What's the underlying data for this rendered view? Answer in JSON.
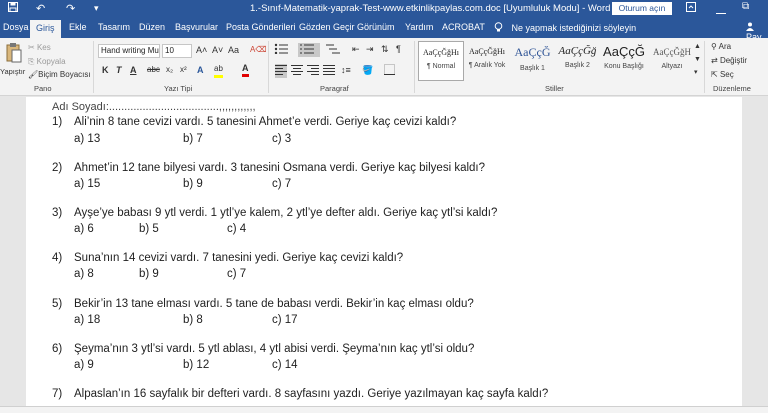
{
  "titlebar": {
    "title": "1.-Sınıf-Matematik-yaprak-Test-www.etkinlikpaylas.com.doc [Uyumluluk Modu] - Word",
    "signin": "Oturum açın",
    "save_icon": "save-icon",
    "undo": "↶",
    "redo": "↷",
    "customize": "▾",
    "restore": "⧉"
  },
  "tabs": [
    "Dosya",
    "Giriş",
    "Ekle",
    "Tasarım",
    "Düzen",
    "Başvurular",
    "Posta Gönderileri",
    "Gözden Geçir",
    "Görünüm",
    "Yardım",
    "ACROBAT"
  ],
  "active_tab": "Giriş",
  "tellme": "Ne yapmak istediğinizi söyleyin",
  "share": "Pay",
  "ribbon": {
    "clipboard": {
      "paste": "Yapıştır",
      "cut": "Kes",
      "copy": "Kopyala",
      "format_painter": "Biçim Boyacısı",
      "label": "Pano"
    },
    "font": {
      "family": "Hand writing Mu",
      "size": "10",
      "grow": "A˄",
      "shrink": "A˅",
      "case": "Aa",
      "bold": "K",
      "italic": "T",
      "underline": "A",
      "strike": "abc",
      "sub": "x₂",
      "sup": "x²",
      "highlight": "ab",
      "color": "A",
      "label": "Yazı Tipi"
    },
    "paragraph": {
      "pilcrow": "¶",
      "label": "Paragraf"
    },
    "styles": {
      "items": [
        {
          "sample": "AaÇçĞğHı",
          "name": "¶ Normal"
        },
        {
          "sample": "AaÇçĞğHı",
          "name": "¶ Aralık Yok"
        },
        {
          "sample": "AaÇçĞ",
          "name": "Başlık 1"
        },
        {
          "sample": "AaÇçĞğ",
          "name": "Başlık 2"
        },
        {
          "sample": "AaÇçĞ",
          "name": "Konu Başlığı"
        },
        {
          "sample": "AaÇçĞğH",
          "name": "Altyazı"
        }
      ],
      "label": "Stiller"
    },
    "editing": {
      "find": "Ara",
      "replace": "Değiştir",
      "select": "Seç",
      "label": "Düzenleme"
    }
  },
  "document": {
    "header": "Adı Soyadı:....................................,,,,,,,,,,,,",
    "questions": [
      {
        "num": "1)",
        "text": "Ali’nin 8 tane cevizi vardı. 5 tanesini Ahmet’e verdi. Geriye kaç cevizi kaldı?",
        "options": [
          "a) 13",
          "b) 7",
          "c) 3"
        ]
      },
      {
        "num": "2)",
        "text": "Ahmet’in 12 tane bilyesi vardı. 3 tanesini Osmana verdi. Geriye kaç bilyesi kaldı?",
        "options": [
          "a) 15",
          "b) 9",
          "c) 7"
        ]
      },
      {
        "num": "3)",
        "text": "Ayşe’ye babası 9 ytl verdi. 1 ytl’ye kalem, 2 ytl’ye defter aldı. Geriye kaç ytl’si kaldı?",
        "options": [
          "a) 6",
          "b) 5",
          "c) 4"
        ]
      },
      {
        "num": "4)",
        "text": "Suna’nın 14 cevizi vardı. 7 tanesini yedi. Geriye kaç cevizi kaldı?",
        "options": [
          "a) 8",
          "b) 9",
          "c) 7"
        ]
      },
      {
        "num": "5)",
        "text": "Bekir’in 13 tane elması vardı. 5 tane de babası verdi. Bekir’in kaç elması oldu?",
        "options": [
          "a) 18",
          "b) 8",
          "c) 17"
        ]
      },
      {
        "num": "6)",
        "text": "Şeyma’nın 3 ytl’si vardı. 5 ytl ablası, 4 ytl abisi verdi. Şeyma’nın kaç ytl’si oldu?",
        "options": [
          "a) 9",
          "b) 12",
          "c) 14"
        ]
      },
      {
        "num": "7)",
        "text": "Alpaslan’ın 16 sayfalık bir defteri vardı. 8 sayfasını yazdı. Geriye yazılmayan kaç sayfa kaldı?",
        "options": []
      }
    ]
  },
  "colors": {
    "accent": "#2b579a",
    "ribbon_bg": "#f3f3f3",
    "doc_bg": "#e6e6e6"
  }
}
